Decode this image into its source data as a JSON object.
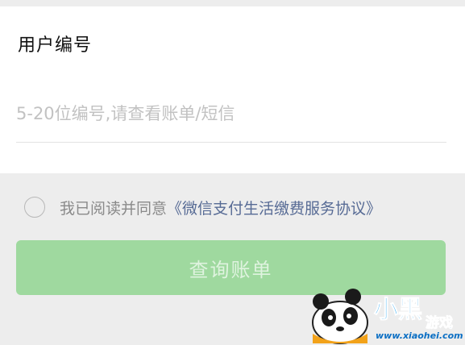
{
  "form": {
    "field_label": "用户编号",
    "input_value": "",
    "input_placeholder": "5-20位编号,请查看账单/短信"
  },
  "agreement": {
    "checked": false,
    "prefix_text": "我已阅读并同意",
    "link_text": "《微信支付生活缴费服务协议》"
  },
  "actions": {
    "query_label": "查询账单",
    "enabled": false
  },
  "colors": {
    "button_bg": "#9fd99f",
    "link": "#576b95",
    "page_bg": "#ededed"
  },
  "watermark": {
    "logo_text": "小黑游戏",
    "site_text": "www.xiaohei.com",
    "icon": "panda-mascot-icon"
  }
}
